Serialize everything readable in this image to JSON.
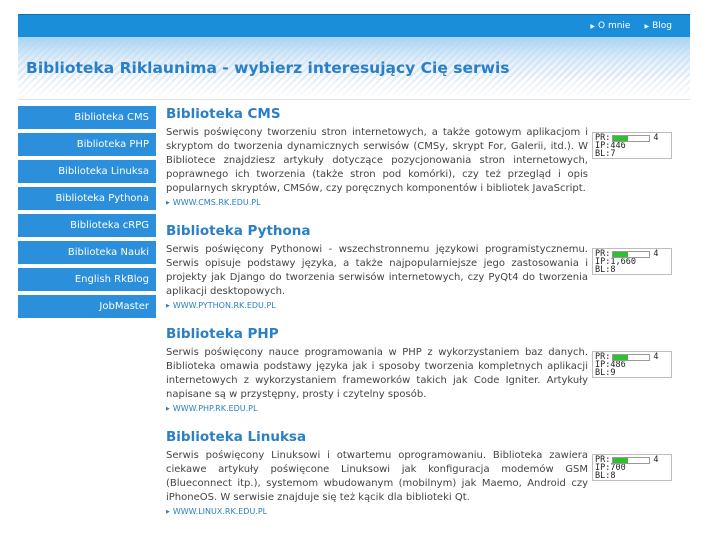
{
  "nav": {
    "links": [
      {
        "label": "O mnie"
      },
      {
        "label": "Blog"
      }
    ]
  },
  "header": {
    "title": "Biblioteka Riklaunima - wybierz interesujący Cię serwis"
  },
  "sidebar": {
    "items": [
      {
        "label": "Biblioteka CMS"
      },
      {
        "label": "Biblioteka PHP"
      },
      {
        "label": "Biblioteka Linuksa"
      },
      {
        "label": "Biblioteka Pythona"
      },
      {
        "label": "Biblioteka cRPG"
      },
      {
        "label": "Biblioteka Nauki"
      },
      {
        "label": "English RkBlog"
      },
      {
        "label": "JobMaster"
      }
    ]
  },
  "entries": [
    {
      "title": "Biblioteka CMS",
      "description": "Serwis poświęcony tworzeniu stron internetowych, a także gotowym aplikacjom i skryptom do tworzenia dynamicznych serwisów (CMSy, skrypt For, Galerii, itd.). W Bibliotece znajdziesz artykuły dotyczące pozycjonowania stron internetowych, poprawnego ich tworzenia (także stron pod komórki), czy też przegląd i opis popularnych skryptów, CMSów, czy poręcznych komponentów i bibliotek JavaScript.",
      "url": "WWW.CMS.RK.EDU.PL",
      "stats": {
        "pr_label": "PR:",
        "pr": 4,
        "pr_max": 10,
        "ip_label": "IP:",
        "ip": "446",
        "bl_label": "BL:",
        "bl": "7"
      }
    },
    {
      "title": "Biblioteka Pythona",
      "description": "Serwis poświęcony Pythonowi - wszechstronnemu językowi programistycznemu. Serwis opisuje podstawy języka, a także najpopularniejsze jego zastosowania i projekty jak Django do tworzenia serwisów internetowych, czy PyQt4 do tworzenia aplikacji desktopowych.",
      "url": "WWW.PYTHON.RK.EDU.PL",
      "stats": {
        "pr_label": "PR:",
        "pr": 4,
        "pr_max": 10,
        "ip_label": "IP:",
        "ip": "1,660",
        "bl_label": "BL:",
        "bl": "8"
      }
    },
    {
      "title": "Biblioteka PHP",
      "description": "Serwis poświęcony nauce programowania w PHP z wykorzystaniem baz danych. Biblioteka omawia podstawy języka jak i sposoby tworzenia kompletnych aplikacji internetowych z wykorzystaniem frameworków takich jak Code Igniter. Artykuły napisane są w przystępny, prosty i czytelny sposób.",
      "url": "WWW.PHP.RK.EDU.PL",
      "stats": {
        "pr_label": "PR:",
        "pr": 4,
        "pr_max": 10,
        "ip_label": "IP:",
        "ip": "486",
        "bl_label": "BL:",
        "bl": "9"
      }
    },
    {
      "title": "Biblioteka Linuksa",
      "description": "Serwis poświęcony Linuksowi i otwartemu oprogramowaniu. Biblioteka zawiera ciekawe artykuły poświęcone Linuksowi jak konfiguracja modemów GSM (Blueconnect itp.), systemom wbudowanym (mobilnym) jak Maemo, Android czy iPhoneOS. W serwisie znajduje się też kącik dla biblioteki Qt.",
      "url": "WWW.LINUX.RK.EDU.PL",
      "stats": {
        "pr_label": "PR:",
        "pr": 4,
        "pr_max": 10,
        "ip_label": "IP:",
        "ip": "700",
        "bl_label": "BL:",
        "bl": "8"
      }
    }
  ],
  "colors": {
    "accent": "#2a7fc6",
    "nav_bar": "#1a8ed8",
    "sidebar_item": "#2b8fdb",
    "pr_fill": "#2fc02f"
  }
}
